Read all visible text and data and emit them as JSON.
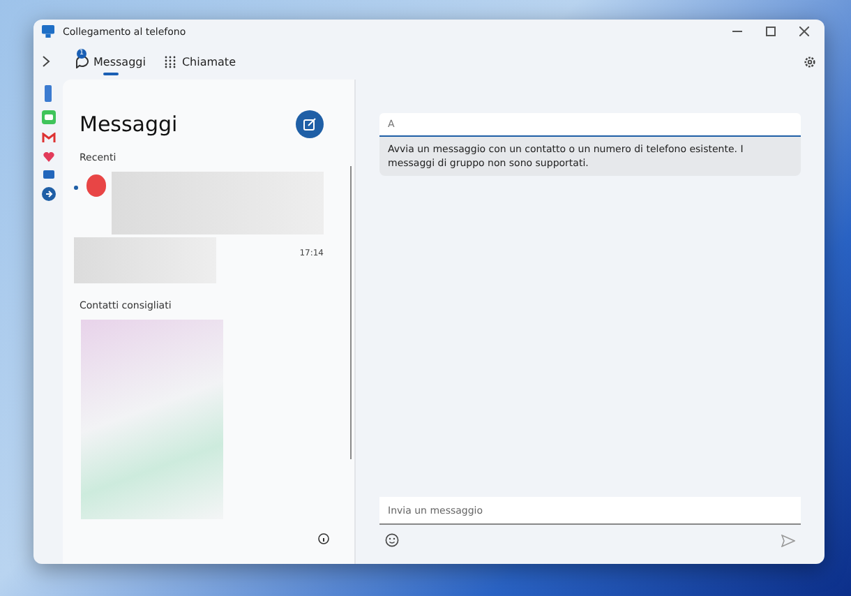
{
  "window": {
    "title": "Collegamento al telefono"
  },
  "tabs": [
    {
      "label": "Messaggi",
      "selected": true,
      "badge": "1",
      "kind": "messages"
    },
    {
      "label": "Chiamate",
      "selected": false,
      "kind": "calls"
    }
  ],
  "messages_panel": {
    "title": "Messaggi",
    "recent_heading": "Recenti",
    "conversations": [
      {
        "unread": true,
        "time": "17:14"
      }
    ],
    "suggested_heading": "Contatti consigliati"
  },
  "compose": {
    "to_placeholder": "A",
    "hint": "Avvia un messaggio con un contatto o un numero di telefono esistente. I messaggi di gruppo non sono supportati.",
    "message_placeholder": "Invia un messaggio"
  }
}
